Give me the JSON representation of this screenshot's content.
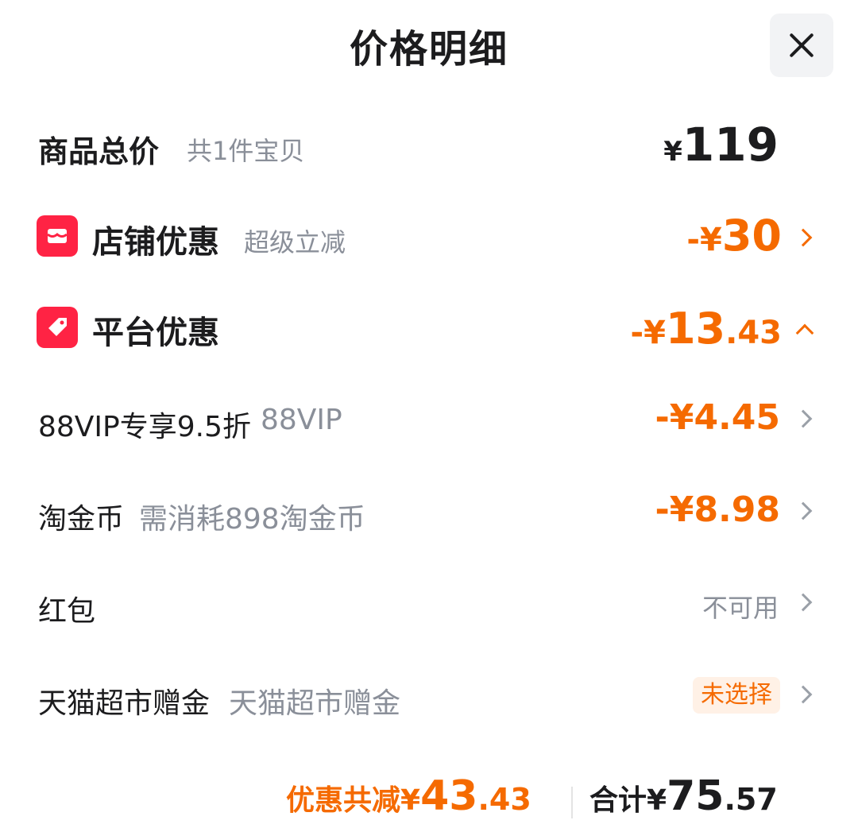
{
  "header": {
    "title": "价格明细",
    "close_icon": "close-icon"
  },
  "goods_total": {
    "label": "商品总价",
    "sub": "共1件宝贝",
    "currency": "¥",
    "amount": "119"
  },
  "shop_discount": {
    "icon": "shop-icon",
    "label": "店铺优惠",
    "sub": "超级立减",
    "prefix": "-¥",
    "amount": "30"
  },
  "platform_discount": {
    "icon": "tag-icon",
    "label": "平台优惠",
    "prefix": "-¥",
    "amount_int": "13",
    "amount_dec": ".43"
  },
  "vip": {
    "label": "88VIP专享9.5折",
    "sub": "88VIP",
    "prefix": "-¥",
    "amount": "4.45"
  },
  "coins": {
    "label": "淘金币",
    "sub": "需消耗898淘金币",
    "prefix": "-¥",
    "amount": "8.98"
  },
  "red_packet": {
    "label": "红包",
    "status": "不可用"
  },
  "tmall_gift": {
    "label": "天猫超市赠金",
    "sub": "天猫超市赠金",
    "status": "未选择"
  },
  "footer": {
    "saved_label": "优惠共减",
    "saved_currency": "¥",
    "saved_int": "43",
    "saved_dec": ".43",
    "total_label": "合计",
    "total_currency": "¥",
    "total_int": "75",
    "total_dec": ".57"
  },
  "colors": {
    "accent": "#f56a00",
    "icon_red": "#ff2344",
    "muted": "#8a8f99"
  }
}
